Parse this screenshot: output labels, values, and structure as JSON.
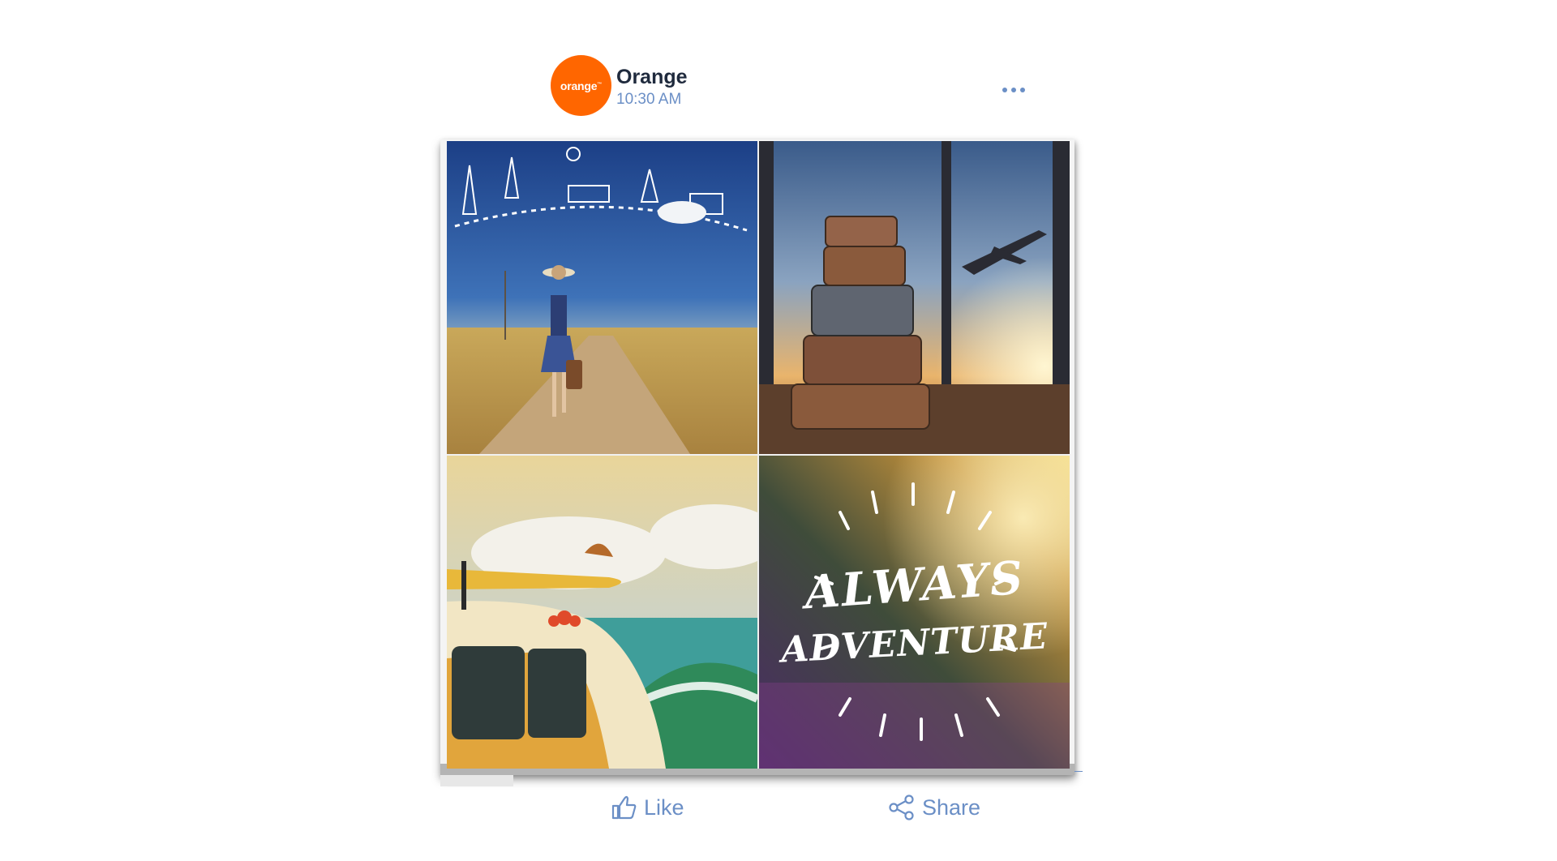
{
  "post": {
    "avatar_text": "orange",
    "avatar_mark": "™",
    "page_name": "Orange",
    "timestamp": "10:30 AM"
  },
  "images": {
    "overlay_line1": "ALWAYS",
    "overlay_line2": "ADVENTURE"
  },
  "actions": {
    "like_label": "Like",
    "share_label": "Share"
  },
  "colors": {
    "brand": "#ff6600",
    "accent": "#6b8fc6",
    "name": "#1f2a3d"
  }
}
